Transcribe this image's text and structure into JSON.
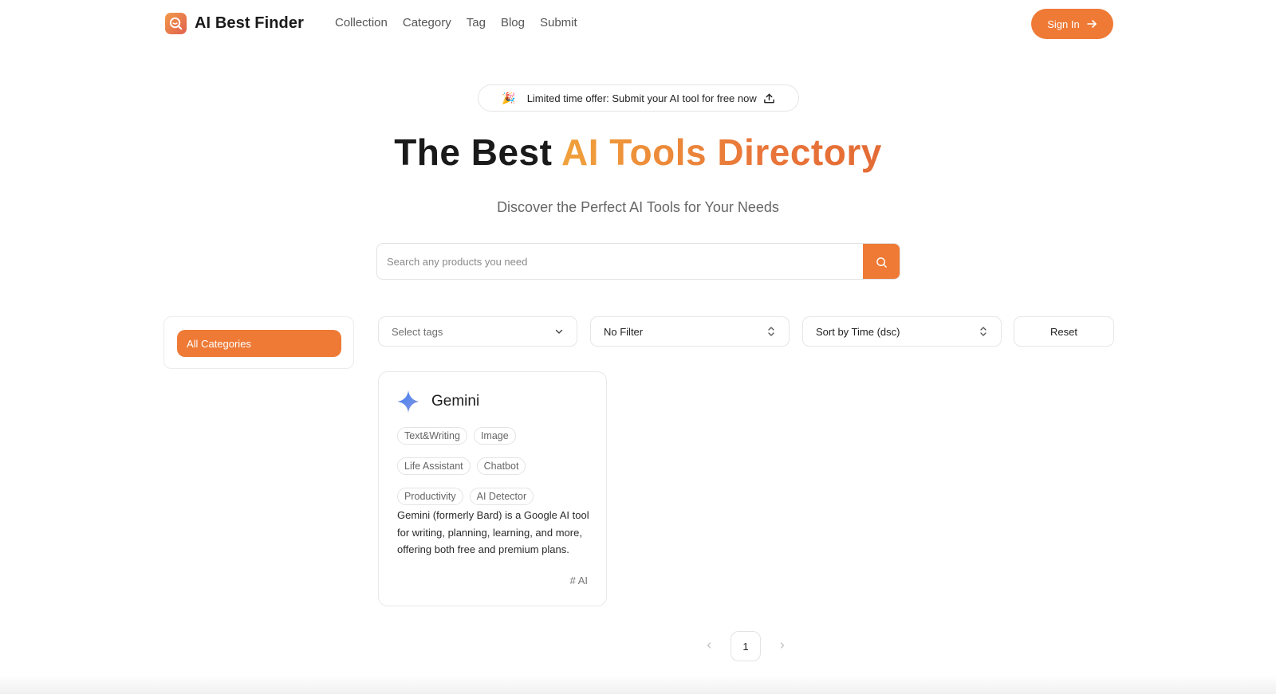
{
  "header": {
    "logo_text": "AI Best Finder",
    "nav": [
      "Collection",
      "Category",
      "Tag",
      "Blog",
      "Submit"
    ],
    "signin_label": "Sign In"
  },
  "offer": {
    "emoji": "🎉",
    "text": "Limited time offer: Submit your AI tool for free now"
  },
  "hero": {
    "title_plain": "The Best ",
    "title_accent": "AI Tools Directory",
    "subtitle": "Discover the Perfect AI Tools for Your Needs"
  },
  "search": {
    "placeholder": "Search any products you need",
    "value": ""
  },
  "sidebar": {
    "category_button": "All Categories"
  },
  "filters": {
    "tags_placeholder": "Select tags",
    "filter_value": "No Filter",
    "sort_value": "Sort by Time (dsc)",
    "reset_label": "Reset"
  },
  "card": {
    "title": "Gemini",
    "tags": [
      "Text&Writing",
      "Image",
      "Life Assistant",
      "Chatbot",
      "Productivity",
      "AI Detector"
    ],
    "description": "Gemini (formerly Bard) is a Google AI tool for writing, planning, learning, and more, offering both free and premium plans.",
    "hashtag": "# AI"
  },
  "pagination": {
    "current": "1"
  },
  "colors": {
    "accent": "#ee7a36",
    "gemini_blue": "#4f7df0"
  }
}
